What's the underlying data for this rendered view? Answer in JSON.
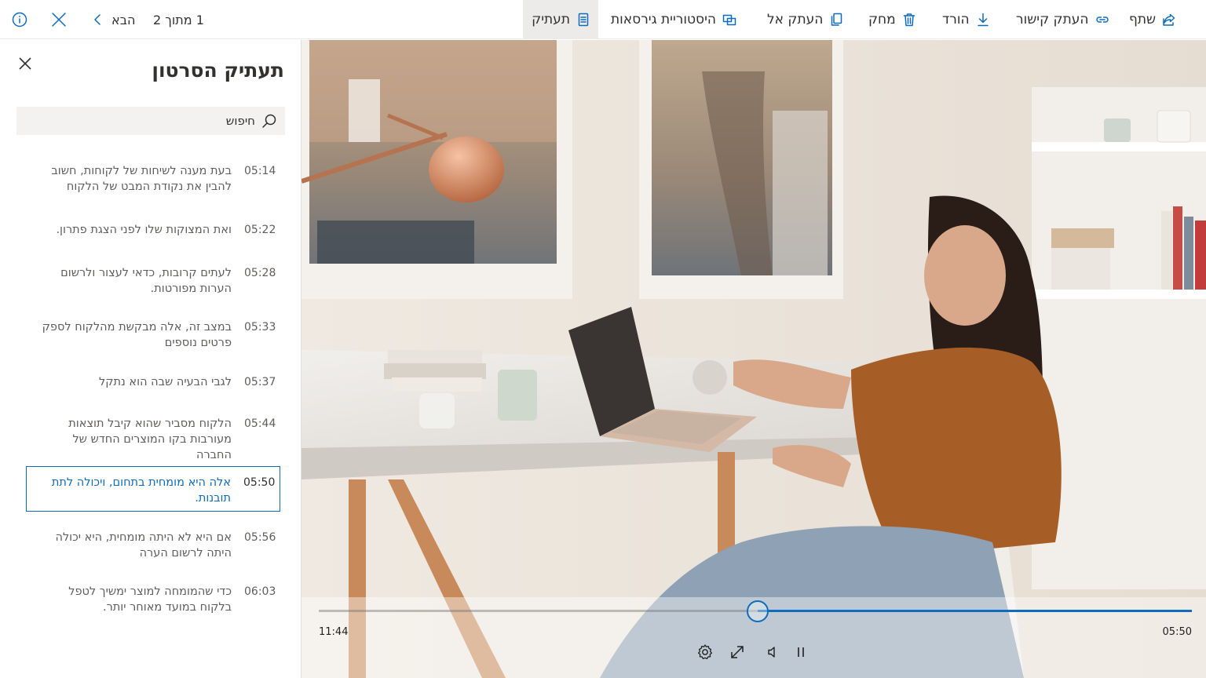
{
  "commandbar": {
    "share_label": "שתף",
    "copy_link_label": "העתק קישור",
    "download_label": "הורד",
    "delete_label": "מחק",
    "copy_to_label": "העתק אל",
    "version_history_label": "היסטוריית גירסאות",
    "transcript_label": "תעתיק",
    "pager_text": "1 מתוך 2",
    "next_label": "הבא"
  },
  "panel": {
    "title": "תעתיק הסרטון",
    "search_placeholder": "חיפוש",
    "items": [
      {
        "time": "05:14",
        "text": "בעת מענה לשיחות של לקוחות, חשוב להבין את נקודת המבט של הלקוח"
      },
      {
        "time": "05:22",
        "text": "ואת המצוקות שלו לפני הצגת פתרון."
      },
      {
        "time": "05:28",
        "text": "לעתים קרובות, כדאי לעצור ולרשום הערות מפורטות."
      },
      {
        "time": "05:33",
        "text": "במצב זה, אלה מבקשת מהלקוח לספק פרטים נוספים"
      },
      {
        "time": "05:37",
        "text": "לגבי הבעיה שבה הוא נתקל"
      },
      {
        "time": "05:44",
        "text": "הלקוח מסביר שהוא קיבל תוצאות מעורבות בקו המוצרים החדש של החברה"
      },
      {
        "time": "05:50",
        "text": "אלה היא מומחית בתחום, ויכולה לתת תובנות.",
        "selected": true
      },
      {
        "time": "05:56",
        "text": "אם היא לא היתה מומחית, היא יכולה היתה לרשום הערה"
      },
      {
        "time": "06:03",
        "text": "כדי שהמומחה למוצר ימשיך לטפל בלקוח במועד מאוחר יותר."
      }
    ]
  },
  "player": {
    "time_elapsed": "05:50",
    "time_remaining": "11:44",
    "progress": 0.497,
    "icons": [
      "settings-icon",
      "fullscreen-icon",
      "volume-icon",
      "pause-icon"
    ]
  },
  "colors": {
    "accent": "#0f6cbd",
    "active_tab_bg": "#edebe9",
    "search_bg": "#f3f2f1"
  }
}
